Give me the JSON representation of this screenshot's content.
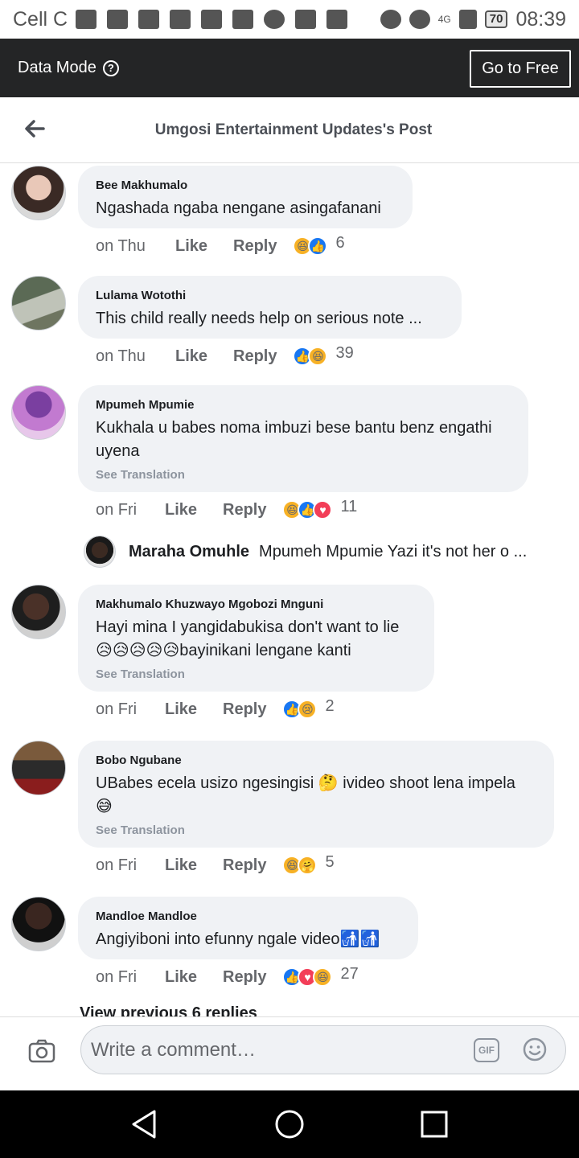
{
  "status_bar": {
    "carrier": "Cell C",
    "battery": "70",
    "time": "08:39",
    "network": "4G"
  },
  "data_bar": {
    "label": "Data Mode",
    "go_free": "Go to Free"
  },
  "header": {
    "title": "Umgosi Entertainment Updates's Post"
  },
  "comments": [
    {
      "name": "Bee Makhumalo",
      "text": "Ngashada ngaba nengane asingafanani",
      "time": "on Thu",
      "like": "Like",
      "reply": "Reply",
      "reactions": [
        "haha",
        "like"
      ],
      "count": "6"
    },
    {
      "name": "Lulama Wotothi",
      "text": "This child really needs help on  serious note ...",
      "time": "on Thu",
      "like": "Like",
      "reply": "Reply",
      "reactions": [
        "like",
        "haha"
      ],
      "count": "39"
    },
    {
      "name": "Mpumeh Mpumie",
      "text": "Kukhala u babes noma imbuzi bese bantu benz engathi uyena",
      "see_translation": "See Translation",
      "time": "on Fri",
      "like": "Like",
      "reply": "Reply",
      "reactions": [
        "haha",
        "like",
        "love"
      ],
      "count": "11"
    },
    {
      "name": "Makhumalo Khuzwayo Mgobozi Mnguni",
      "text": "Hayi mina I yangidabukisa don't want to lie 😥😥😥😥😥bayinikani lengane kanti",
      "see_translation": "See Translation",
      "time": "on Fri",
      "like": "Like",
      "reply": "Reply",
      "reactions": [
        "like",
        "sad"
      ],
      "count": "2"
    },
    {
      "name": "Bobo Ngubane",
      "text": "UBabes ecela usizo ngesingisi 🤔 ivideo shoot lena impela 😅",
      "see_translation": "See Translation",
      "time": "on Fri",
      "like": "Like",
      "reply": "Reply",
      "reactions": [
        "haha",
        "care"
      ],
      "count": "5"
    },
    {
      "name": "Mandloe Mandloe",
      "text": "Angiyiboni into efunny ngale video🚮🚮",
      "time": "on Fri",
      "like": "Like",
      "reply": "Reply",
      "reactions": [
        "like",
        "love",
        "haha"
      ],
      "count": "27"
    }
  ],
  "reply_preview": {
    "name": "Maraha Omuhle",
    "text": "Mpumeh Mpumie  Yazi it's not her o ..."
  },
  "view_previous": "View previous 6 replies",
  "composer": {
    "placeholder": "Write a comment…",
    "gif": "GIF"
  }
}
